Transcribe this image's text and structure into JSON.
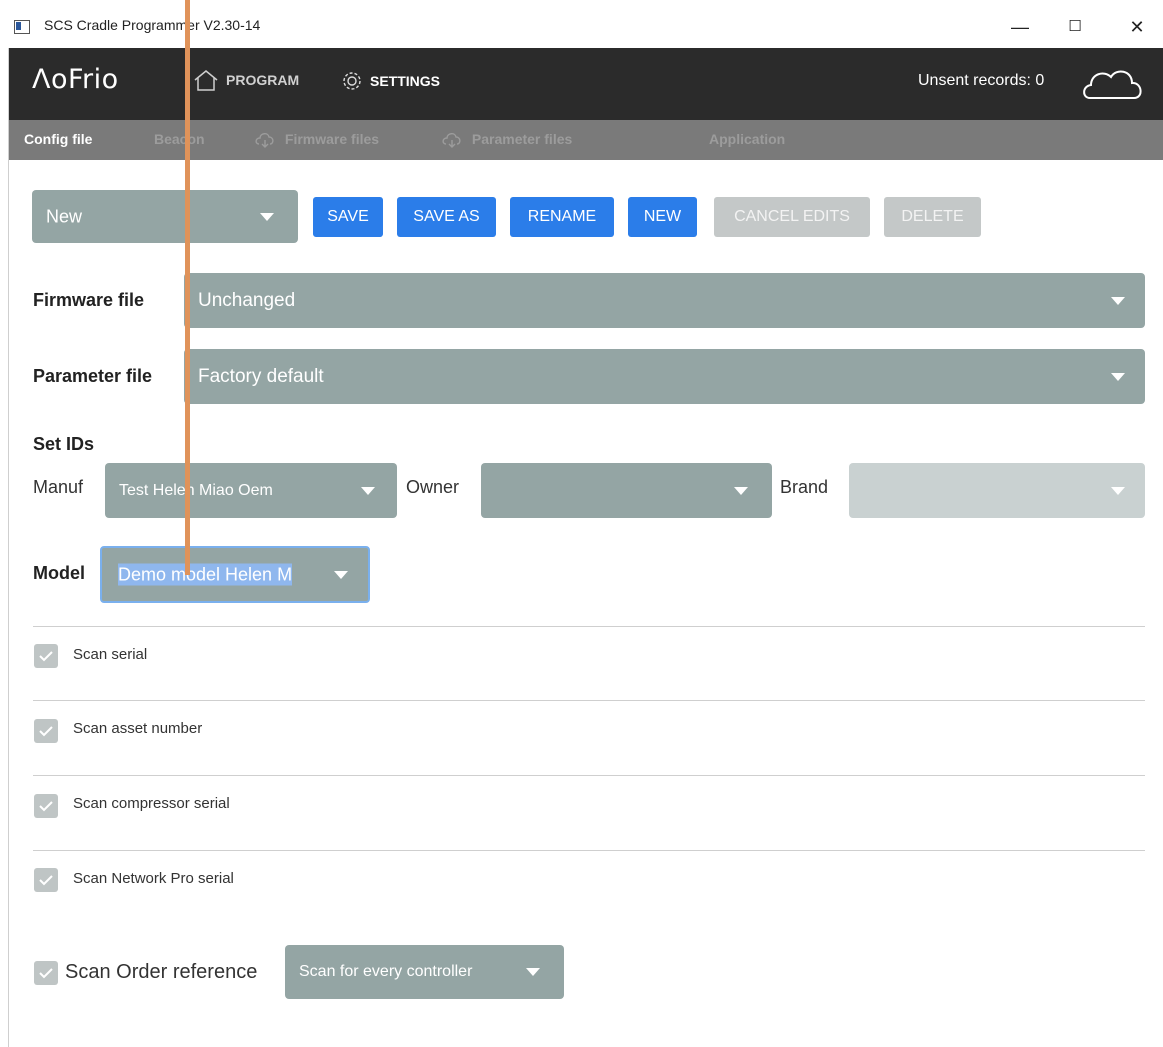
{
  "window": {
    "title": "SCS Cradle Programmer V2.30-14",
    "minimize": "—",
    "maximize": "☐",
    "close": "✕"
  },
  "header": {
    "brand": "ΛoFrio",
    "nav": [
      {
        "label": "PROGRAM",
        "icon": "home-icon"
      },
      {
        "label": "SETTINGS",
        "icon": "gear-icon"
      }
    ],
    "unsent_records": "Unsent records: 0",
    "cloud_icon": "cloud-icon"
  },
  "subnav": {
    "tabs": [
      {
        "label": "Config file",
        "active": true
      },
      {
        "label": "Beacon",
        "active": false
      },
      {
        "label": "Firmware files",
        "icon": "cloud-download-icon",
        "active": false
      },
      {
        "label": "Parameter files",
        "icon": "cloud-download-icon",
        "active": false
      },
      {
        "label": "Application",
        "active": false
      }
    ]
  },
  "config": {
    "selected": "New",
    "buttons": {
      "save": "SAVE",
      "save_as": "SAVE AS",
      "rename": "RENAME",
      "new": "NEW",
      "cancel_edits": "CANCEL EDITS",
      "delete": "DELETE"
    }
  },
  "firmware": {
    "label": "Firmware file",
    "value": "Unchanged"
  },
  "parameter": {
    "label": "Parameter file",
    "value": "Factory default"
  },
  "set_ids": {
    "heading": "Set IDs",
    "manuf_label": "Manuf",
    "manuf_value": "Test Helen Miao Oem",
    "owner_label": "Owner",
    "owner_value": "",
    "brand_label": "Brand",
    "brand_value": ""
  },
  "model": {
    "label": "Model",
    "value": "Demo model Helen M"
  },
  "scans": [
    {
      "label": "Scan serial",
      "checked": true
    },
    {
      "label": "Scan asset number",
      "checked": true
    },
    {
      "label": "Scan compressor serial",
      "checked": true
    },
    {
      "label": "Scan Network Pro serial",
      "checked": true
    }
  ],
  "order": {
    "label": "Scan Order reference",
    "checked": true,
    "value": "Scan for every controller"
  },
  "colors": {
    "accent_blue": "#2b7de9",
    "select_grey": "#94a5a4",
    "header_dark": "#2b2b2b",
    "annotation": "#e0935a"
  }
}
